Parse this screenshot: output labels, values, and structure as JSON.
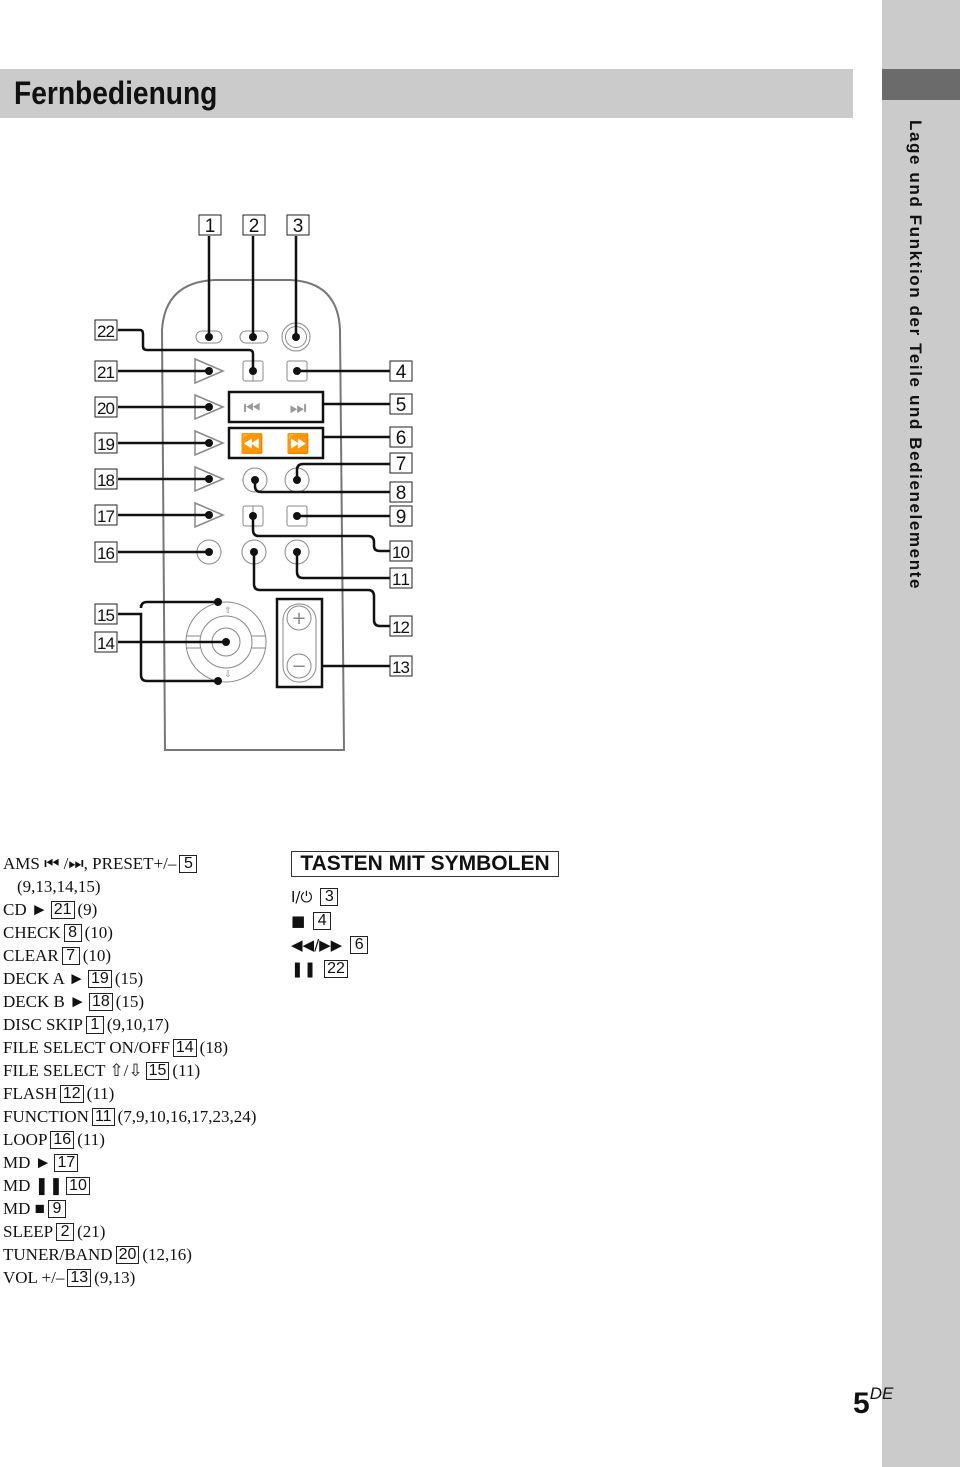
{
  "header": {
    "title": "Fernbedienung"
  },
  "sidebar": {
    "section_title": "Lage und Funktion der Teile und Bedienelemente"
  },
  "diagram": {
    "callouts": [
      "1",
      "2",
      "3",
      "4",
      "5",
      "6",
      "7",
      "8",
      "9",
      "10",
      "11",
      "12",
      "13",
      "14",
      "15",
      "16",
      "17",
      "18",
      "19",
      "20",
      "21",
      "22"
    ],
    "file_select_up_icon": "⇧",
    "file_select_down_icon": "⇩"
  },
  "list": [
    {
      "label": "AMS ⏮ /⏭, PRESET+/–",
      "num": "5",
      "pages": ""
    },
    {
      "label": "",
      "num": "",
      "pages": "(9,13,14,15)",
      "indent": true
    },
    {
      "label": "CD ►",
      "num": "21",
      "pages": "(9)"
    },
    {
      "label": "CHECK",
      "num": "8",
      "pages": "(10)"
    },
    {
      "label": "CLEAR",
      "num": "7",
      "pages": "(10)"
    },
    {
      "label": "DECK A ►",
      "num": "19",
      "pages": "(15)"
    },
    {
      "label": "DECK B ►",
      "num": "18",
      "pages": "(15)"
    },
    {
      "label": "DISC SKIP",
      "num": "1",
      "pages": "(9,10,17)"
    },
    {
      "label": "FILE SELECT ON/OFF",
      "num": "14",
      "pages": "(18)"
    },
    {
      "label": "FILE SELECT ⇧/⇩",
      "num": "15",
      "pages": "(11)"
    },
    {
      "label": "FLASH",
      "num": "12",
      "pages": "(11)"
    },
    {
      "label": "FUNCTION",
      "num": "11",
      "pages": "(7,9,10,16,17,23,24)"
    },
    {
      "label": "LOOP",
      "num": "16",
      "pages": "(11)"
    },
    {
      "label": "MD ►",
      "num": "17",
      "pages": ""
    },
    {
      "label": "MD ❚❚",
      "num": "10",
      "pages": ""
    },
    {
      "label": "MD ■",
      "num": "9",
      "pages": ""
    },
    {
      "label": "SLEEP",
      "num": "2",
      "pages": "(21)"
    },
    {
      "label": "TUNER/BAND",
      "num": "20",
      "pages": "(12,16)"
    },
    {
      "label": "VOL +/–",
      "num": "13",
      "pages": "(9,13)"
    }
  ],
  "symbols": {
    "title": "TASTEN MIT SYMBOLEN",
    "items": [
      {
        "symbol": "I/⏻",
        "num": "3"
      },
      {
        "symbol": "■",
        "num": "4"
      },
      {
        "symbol": "◀◀/▶▶",
        "num": "6"
      },
      {
        "symbol": "❚❚",
        "num": "22"
      }
    ]
  },
  "page": {
    "number": "5",
    "suffix": "DE"
  }
}
